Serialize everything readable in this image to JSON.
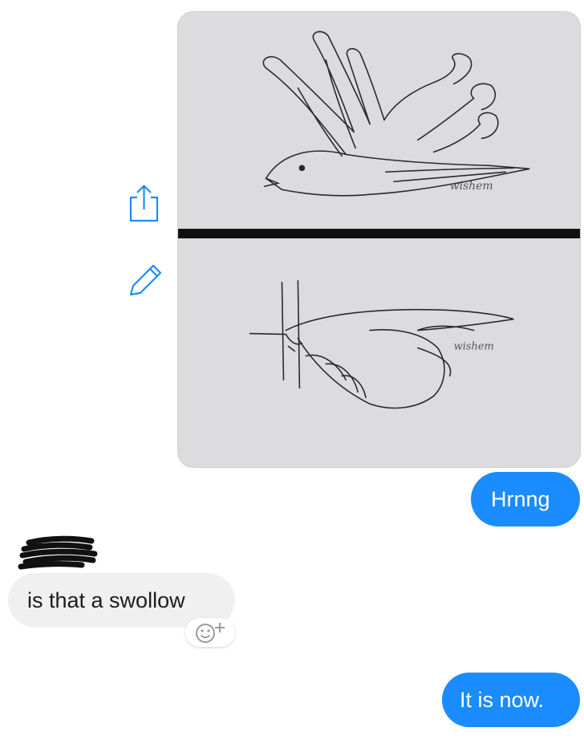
{
  "conversation": {
    "attachment": {
      "watermark_top": "wishem",
      "watermark_bottom": "wishem"
    },
    "messages": [
      {
        "sender": "me",
        "text": "Hrnng"
      },
      {
        "sender": "them",
        "text": "is that a swollow"
      },
      {
        "sender": "me",
        "text": "It is now."
      }
    ]
  },
  "icons": {
    "share": "share-icon",
    "edit": "pencil-icon",
    "reaction": "add-reaction-icon"
  },
  "colors": {
    "sent_bubble": "#1a8cff",
    "received_bubble": "#f0f0f0",
    "icon_accent": "#1a8cff"
  }
}
